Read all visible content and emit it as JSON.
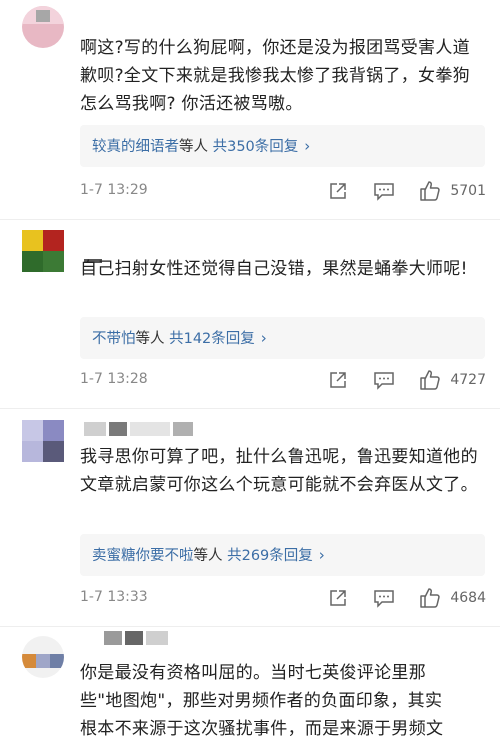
{
  "comments": [
    {
      "content": "啊这?写的什么狗屁啊，你还是没为报团骂受害人道歉呗?全文下来就是我惨我太惨了我背锅了，女拳狗怎么骂我啊? 你活还被骂嗷。",
      "reply_names": "较真的细语者",
      "reply_mid": "等人",
      "reply_count": "共350条回复",
      "time": "1-7 13:29",
      "likes": "5701"
    },
    {
      "content": "自己扫射女性还觉得自己没错，果然是蛹拳大师呢!",
      "reply_names": "不带怕",
      "reply_mid": "等人",
      "reply_count": "共142条回复",
      "time": "1-7 13:28",
      "likes": "4727"
    },
    {
      "content": "我寻思你可算了吧，扯什么鲁迅呢，鲁迅要知道他的文章就启蒙可你这么个玩意可能就不会弃医从文了。",
      "reply_names": "卖蜜糖你要不啦",
      "reply_mid": "等人",
      "reply_count": "共269条回复",
      "time": "1-7 13:33",
      "likes": "4684"
    },
    {
      "content_line1": "你是最没有资格叫屈的。当时七英俊评论里那",
      "content_line2": "些\"地图炮\"，那些对男频作者的负面印象，其实",
      "content_line3": "根本不来源于这次骚扰事件，而是来源于男频文"
    }
  ],
  "icons": {
    "share": "share-icon",
    "comment": "comment-icon",
    "like": "thumbs-up-icon",
    "chevron": "chevron-right-icon"
  },
  "colors": {
    "link_blue": "#3c6ea6",
    "reply_bg": "#f6f6f6",
    "meta_gray": "#888888"
  }
}
